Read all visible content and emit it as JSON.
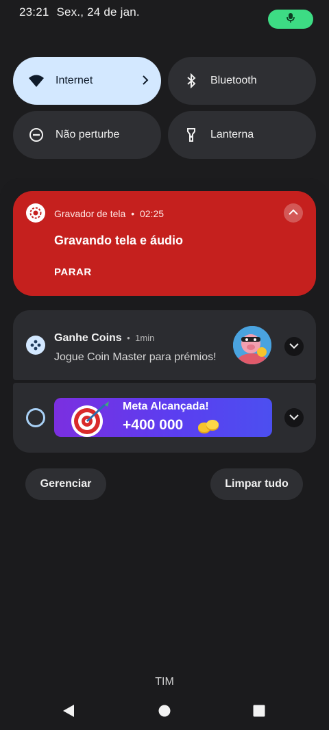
{
  "status_bar": {
    "time": "23:21",
    "date": "Sex., 24 de jan.",
    "mic_indicator": "mic-icon",
    "mic_color": "#3ddc84"
  },
  "quick_settings": [
    {
      "label": "Internet",
      "icon": "wifi-icon",
      "active": true
    },
    {
      "label": "Bluetooth",
      "icon": "bluetooth-icon",
      "active": false
    },
    {
      "label": "Não perturbe",
      "icon": "do-not-disturb-icon",
      "active": false
    },
    {
      "label": "Lanterna",
      "icon": "flashlight-icon",
      "active": false
    }
  ],
  "recorder_notification": {
    "app": "Gravador de tela",
    "separator": "•",
    "timer": "02:25",
    "title": "Gravando tela e áudio",
    "action": "PARAR",
    "color": "#c5201e"
  },
  "notifications": [
    {
      "title": "Ganhe Coins",
      "separator": "•",
      "time": "1min",
      "text": "Jogue Coin Master para prémios!",
      "icon": "game-controller-icon"
    },
    {
      "banner_title": "Meta Alcançada!",
      "banner_value": "+400 000",
      "icon": "ring-icon"
    }
  ],
  "actions": {
    "manage": "Gerenciar",
    "clear_all": "Limpar tudo"
  },
  "carrier": "TIM",
  "nav": [
    "back-icon",
    "home-icon",
    "recents-icon"
  ]
}
